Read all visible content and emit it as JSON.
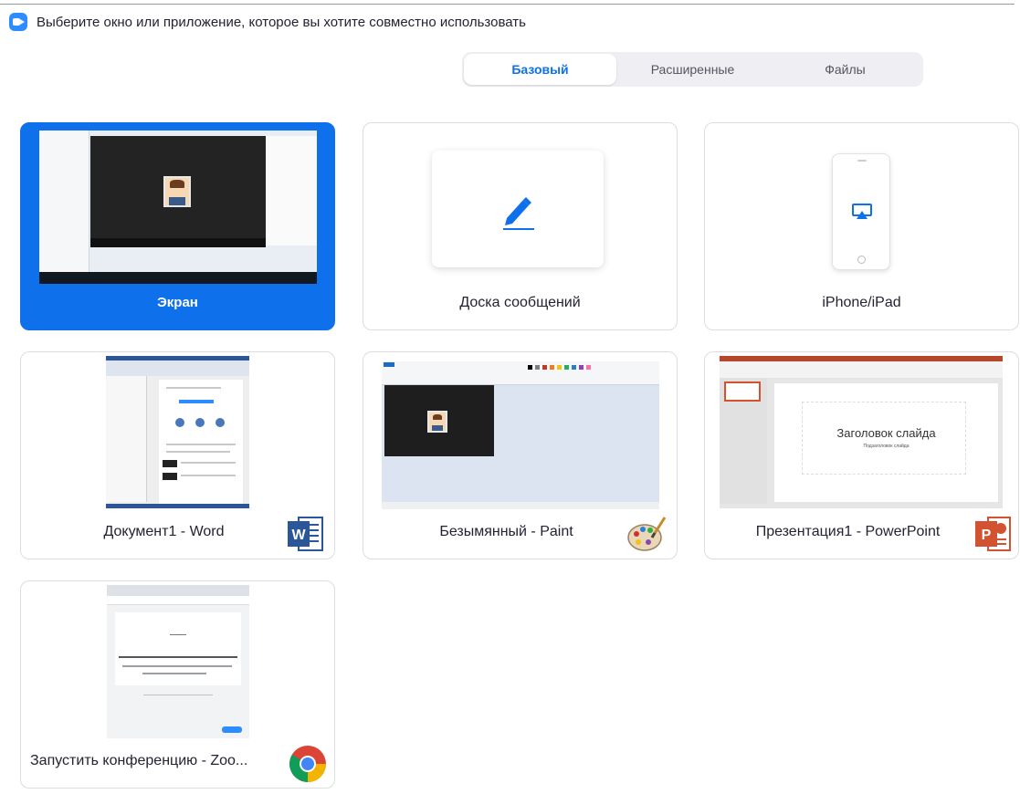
{
  "window": {
    "title": "Выберите окно или приложение, которое вы хотите совместно использовать"
  },
  "tabs": [
    {
      "label": "Базовый",
      "active": true
    },
    {
      "label": "Расширенные",
      "active": false
    },
    {
      "label": "Файлы",
      "active": false
    }
  ],
  "share_options": [
    {
      "label": "Экран",
      "selected": true
    },
    {
      "label": "Доска сообщений",
      "selected": false
    },
    {
      "label": "iPhone/iPad",
      "selected": false
    },
    {
      "label": "Документ1 - Word",
      "app_icon": "word-icon"
    },
    {
      "label": "Безымянный - Paint",
      "app_icon": "paint-icon"
    },
    {
      "label": "Презентация1 - PowerPoint",
      "app_icon": "powerpoint-icon"
    },
    {
      "label": "Запустить конференцию - Zoo...",
      "app_icon": "chrome-icon"
    }
  ],
  "previews": {
    "powerpoint_slide_title": "Заголовок слайда",
    "powerpoint_slide_subtitle": "Подзаголовок слайда"
  },
  "colors": {
    "accent": "#0e71eb",
    "app_icon": "#2d8cff",
    "word": "#2b579a",
    "powerpoint": "#d35230"
  }
}
